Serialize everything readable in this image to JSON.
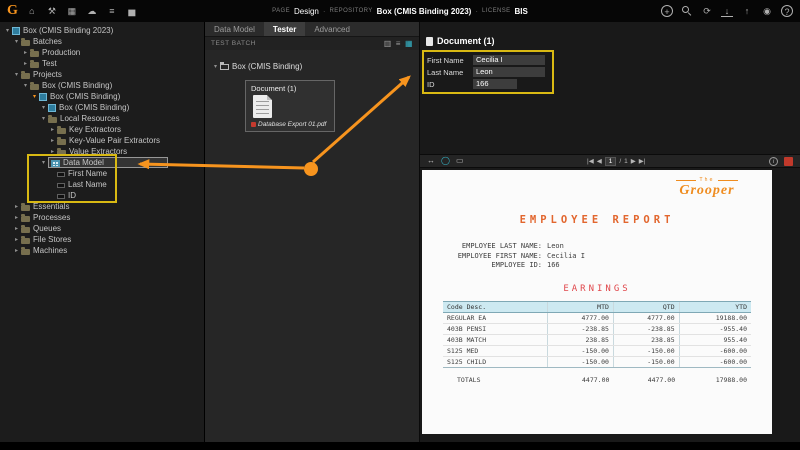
{
  "colors": {
    "accent_orange": "#f7941e",
    "highlight_yellow": "#d9b913",
    "teal": "#35b6c9",
    "table_header_bg": "#cde9f1",
    "report_title_orange": "#e2662e",
    "report_red": "#e0474b"
  },
  "topbar": {
    "logo": "G",
    "left_icons": [
      {
        "name": "home-icon",
        "glyph": "⌂"
      },
      {
        "name": "tools-icon",
        "glyph": "⚒"
      },
      {
        "name": "batches-icon",
        "glyph": "▦"
      },
      {
        "name": "cloud-icon",
        "glyph": "☁"
      },
      {
        "name": "infrastructure-icon",
        "glyph": "≡"
      },
      {
        "name": "stats-icon",
        "glyph": "▅"
      }
    ],
    "meta": {
      "page_label": "PAGE",
      "page_value": "Design",
      "sep1": "·",
      "repository_label": "REPOSITORY",
      "repository_value": "Box (CMIS Binding 2023)",
      "sep2": "·",
      "license_label": "LICENSE",
      "license_value": "BIS"
    },
    "right_icons": [
      {
        "name": "add-icon",
        "glyph": "+",
        "circle": true
      },
      {
        "name": "search-icon",
        "glyph": ""
      },
      {
        "name": "refresh-icon",
        "glyph": "⟳"
      },
      {
        "name": "download-icon",
        "glyph": "↓"
      },
      {
        "name": "upload-icon",
        "glyph": "↑"
      },
      {
        "name": "user-icon",
        "glyph": "◉"
      },
      {
        "name": "help-icon",
        "glyph": "?",
        "circle": true
      }
    ]
  },
  "sidebar": {
    "tree": [
      {
        "label": "Box (CMIS Binding 2023)",
        "level": 0,
        "exp": "open",
        "icon": "cube"
      },
      {
        "label": "Batches",
        "level": 1,
        "exp": "open",
        "icon": "folder"
      },
      {
        "label": "Production",
        "level": 2,
        "exp": "closed",
        "icon": "folder"
      },
      {
        "label": "Test",
        "level": 2,
        "exp": "closed",
        "icon": "folder"
      },
      {
        "label": "Projects",
        "level": 1,
        "exp": "open",
        "icon": "folder"
      },
      {
        "label": "Box (CMIS Binding)",
        "level": 2,
        "exp": "open",
        "icon": "folder"
      },
      {
        "label": "Box (CMIS Binding)",
        "level": 3,
        "exp": "open",
        "icon": "cube",
        "accent": true
      },
      {
        "label": "Box (CMIS Binding)",
        "level": 4,
        "exp": "open",
        "icon": "cube"
      },
      {
        "label": "Local Resources",
        "level": 4,
        "exp": "open",
        "icon": "folder"
      },
      {
        "label": "Key Extractors",
        "level": 5,
        "exp": "closed",
        "icon": "folder"
      },
      {
        "label": "Key-Value Pair Extractors",
        "level": 5,
        "exp": "closed",
        "icon": "folder"
      },
      {
        "label": "Value Extractors",
        "level": 5,
        "exp": "closed",
        "icon": "folder"
      },
      {
        "label": "Data Model",
        "level": 4,
        "exp": "open",
        "icon": "datamodel",
        "selected": true
      },
      {
        "label": "First Name",
        "level": 5,
        "exp": "none",
        "icon": "field"
      },
      {
        "label": "Last Name",
        "level": 5,
        "exp": "none",
        "icon": "field"
      },
      {
        "label": "ID",
        "level": 5,
        "exp": "none",
        "icon": "field"
      },
      {
        "label": "Essentials",
        "level": 1,
        "exp": "closed",
        "icon": "folder"
      },
      {
        "label": "Processes",
        "level": 1,
        "exp": "closed",
        "icon": "folder"
      },
      {
        "label": "Queues",
        "level": 1,
        "exp": "closed",
        "icon": "folder"
      },
      {
        "label": "File Stores",
        "level": 1,
        "exp": "closed",
        "icon": "folder"
      },
      {
        "label": "Machines",
        "level": 1,
        "exp": "closed",
        "icon": "folder"
      }
    ]
  },
  "tester": {
    "tabs": [
      {
        "label": "Data Model",
        "active": false
      },
      {
        "label": "Tester",
        "active": true
      },
      {
        "label": "Advanced",
        "active": false
      }
    ],
    "batch_label": "TEST BATCH",
    "batch_icons": [
      {
        "name": "tree-view-icon",
        "glyph": "▥",
        "color": "#9a9a9a"
      },
      {
        "name": "list-view-icon",
        "glyph": "≡",
        "color": "#9a9a9a"
      },
      {
        "name": "thumbnail-view-icon",
        "glyph": "▦",
        "color": "#35b6c9"
      }
    ],
    "root_expander": "▾",
    "root_folder": "Box (CMIS Binding)",
    "document": {
      "title": "Document (1)",
      "file": "Database Export 01.pdf"
    }
  },
  "document_panel": {
    "title": "Document (1)",
    "fields": [
      {
        "label": "First Name",
        "value": "Cecilia I"
      },
      {
        "label": "Last Name",
        "value": "Leon"
      },
      {
        "label": "ID",
        "value": "166",
        "narrow": true
      }
    ],
    "viewer": {
      "left_icons": [
        {
          "name": "fit-width-icon",
          "glyph": "↔"
        },
        {
          "name": "select-region-icon",
          "glyph": "◯"
        },
        {
          "name": "layout-icon",
          "glyph": "▭"
        }
      ],
      "nav": {
        "first": "|◀",
        "prev": "◀",
        "page": "1",
        "sep": "/",
        "total": "1",
        "next": "▶",
        "last": "▶|"
      },
      "info_glyph": "i"
    }
  },
  "preview": {
    "brand_top": "The",
    "brand": "Grooper",
    "title": "EMPLOYEE REPORT",
    "fields": [
      {
        "label": "EMPLOYEE LAST NAME:",
        "value": "Leon"
      },
      {
        "label": "EMPLOYEE FIRST NAME:",
        "value": "Cecilia I"
      },
      {
        "label": "EMPLOYEE ID:",
        "value": "166"
      }
    ],
    "earnings_title": "EARNINGS",
    "table": {
      "columns": [
        "Code Desc.",
        "MTD",
        "QTD",
        "YTD"
      ],
      "rows": [
        [
          "REGULAR EA",
          "4777.00",
          "4777.00",
          "19188.00"
        ],
        [
          "403B PENSI",
          "-238.85",
          "-238.85",
          "-955.40"
        ],
        [
          "403B MATCH",
          "238.85",
          "238.85",
          "955.40"
        ],
        [
          "S125 MED",
          "-150.00",
          "-150.00",
          "-600.00"
        ],
        [
          "S125 CHILD",
          "-150.00",
          "-150.00",
          "-600.00"
        ]
      ],
      "totals": [
        "TOTALS",
        "4477.00",
        "4477.00",
        "17988.00"
      ]
    }
  }
}
